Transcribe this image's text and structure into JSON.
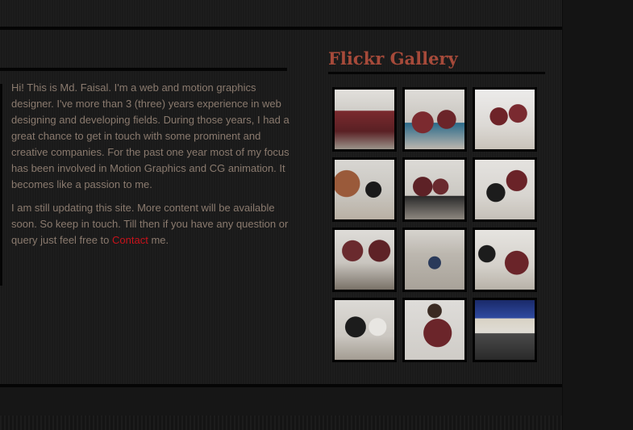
{
  "about": {
    "paragraph_1": "Hi! This is Md. Faisal. I'm a web and motion graphics designer. I've more than 3 (three) years experience in web designing and developing fields. During those years, I had a great chance to get in touch with some prominent and creative companies. For the past one year most of my focus has been involved in Motion Graphics and CG animation. It becomes like a passion to me.",
    "paragraph_2_before_link": "I am still updating this site. More content will be available soon. So keep in touch. Till then if you have any question or query just feel free to ",
    "contact_link": "Contact",
    "paragraph_2_after_link": " me."
  },
  "gallery": {
    "title": "Flickr Gallery",
    "thumbnails": [
      {
        "name": "flickr-photo-1",
        "scene": "scene-a"
      },
      {
        "name": "flickr-photo-2",
        "scene": "scene-b"
      },
      {
        "name": "flickr-photo-3",
        "scene": "scene-c"
      },
      {
        "name": "flickr-photo-4",
        "scene": "scene-d"
      },
      {
        "name": "flickr-photo-5",
        "scene": "scene-e"
      },
      {
        "name": "flickr-photo-6",
        "scene": "scene-f"
      },
      {
        "name": "flickr-photo-7",
        "scene": "scene-g"
      },
      {
        "name": "flickr-photo-8",
        "scene": "scene-h"
      },
      {
        "name": "flickr-photo-9",
        "scene": "scene-i"
      },
      {
        "name": "flickr-photo-10",
        "scene": "scene-j"
      },
      {
        "name": "flickr-photo-11",
        "scene": "scene-k"
      },
      {
        "name": "flickr-photo-12",
        "scene": "scene-l"
      }
    ]
  },
  "colors": {
    "background": "#1a1a1a",
    "body_text": "#8a7a6e",
    "heading": "#a64a3a",
    "link": "#c8121b",
    "divider": "#050505"
  }
}
